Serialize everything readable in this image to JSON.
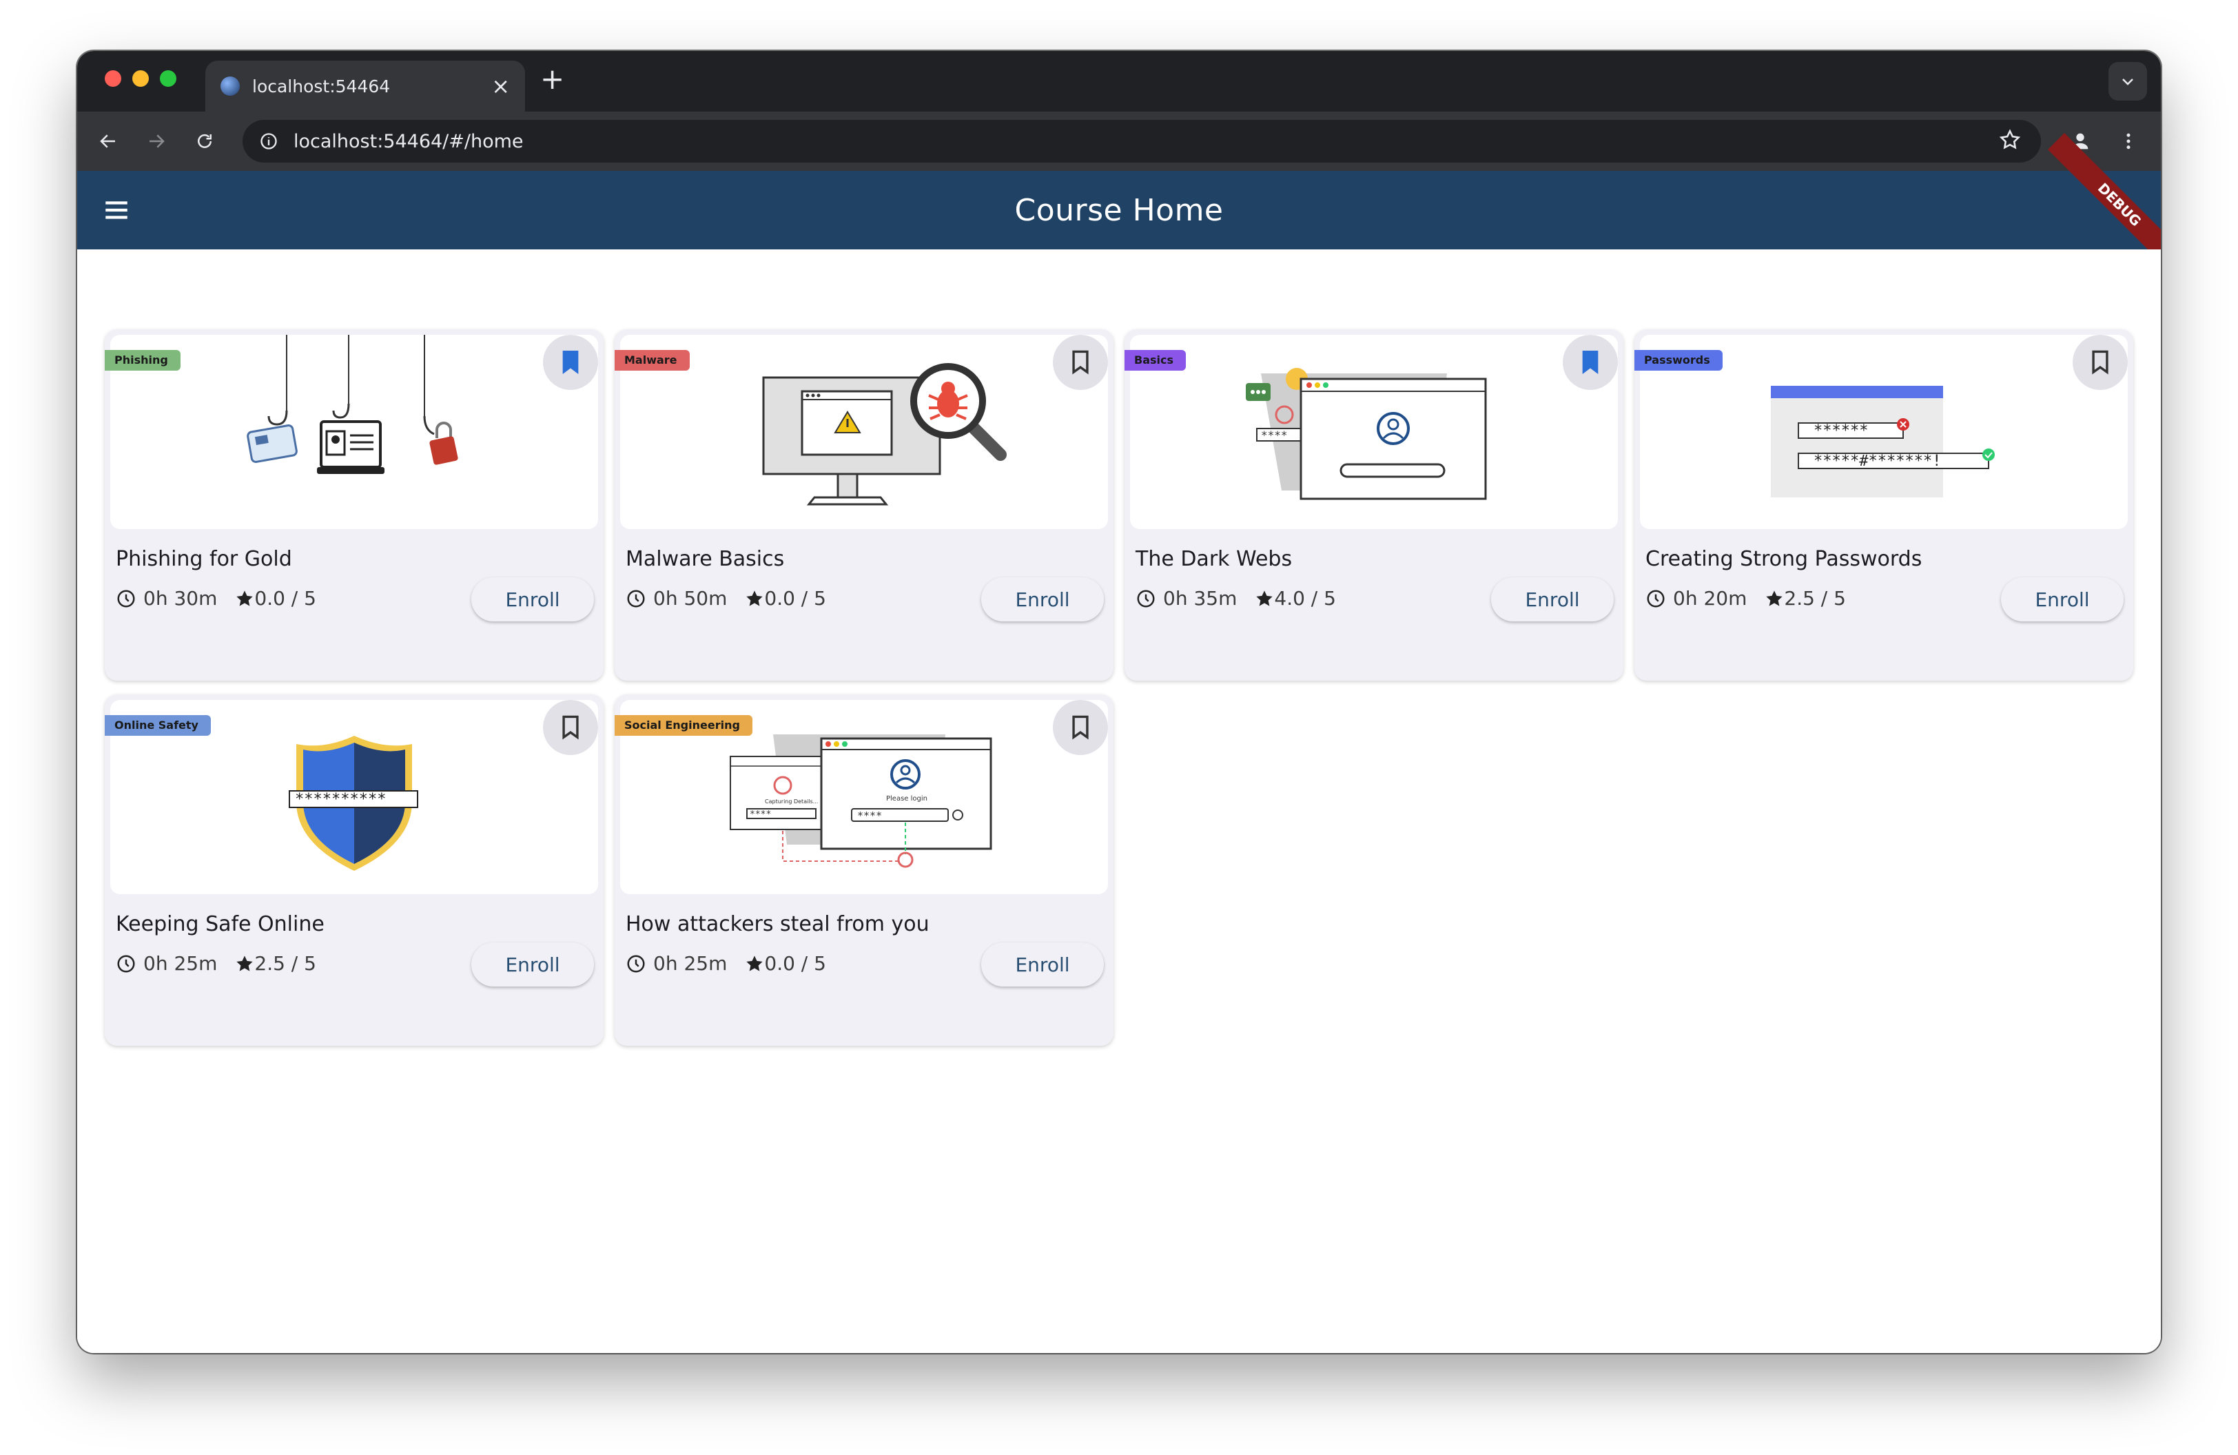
{
  "browser": {
    "tab_title": "localhost:54464",
    "url": "localhost:54464/#/home"
  },
  "appbar": {
    "title": "Course Home",
    "debug_label": "DEBUG"
  },
  "colors": {
    "appbar": "#1f4265",
    "accent_text": "#284e72",
    "bookmark_active": "#2a6fd6"
  },
  "courses": [
    {
      "tag": "Phishing",
      "tag_color": "#7fba7c",
      "title": "Phishing for Gold",
      "duration": "0h 30m",
      "rating": "0.0 / 5",
      "enroll": "Enroll",
      "bookmarked": true,
      "icon": "phishing-illustration"
    },
    {
      "tag": "Malware",
      "tag_color": "#e06363",
      "title": "Malware Basics",
      "duration": "0h 50m",
      "rating": "0.0 / 5",
      "enroll": "Enroll",
      "bookmarked": false,
      "icon": "malware-illustration"
    },
    {
      "tag": "Basics",
      "tag_color": "#8a55e8",
      "title": "The Dark Webs",
      "duration": "0h 35m",
      "rating": "4.0 / 5",
      "enroll": "Enroll",
      "bookmarked": true,
      "icon": "darkweb-illustration"
    },
    {
      "tag": "Passwords",
      "tag_color": "#5a73e8",
      "title": "Creating Strong Passwords",
      "duration": "0h 20m",
      "rating": "2.5 / 5",
      "enroll": "Enroll",
      "bookmarked": false,
      "icon": "passwords-illustration"
    },
    {
      "tag": "Online Safety",
      "tag_color": "#6f95d8",
      "title": "Keeping Safe Online",
      "duration": "0h 25m",
      "rating": "2.5 / 5",
      "enroll": "Enroll",
      "bookmarked": false,
      "icon": "shield-illustration"
    },
    {
      "tag": "Social Engineering",
      "tag_color": "#e8a94a",
      "title": "How attackers steal from you",
      "duration": "0h 25m",
      "rating": "0.0 / 5",
      "enroll": "Enroll",
      "bookmarked": false,
      "icon": "social-engineering-illustration"
    }
  ],
  "illustration_text": {
    "masked_short": "******",
    "masked_long": "*****#*******!",
    "shield_mask": "**********",
    "four_stars": "****",
    "please_login": "Please login",
    "capturing_details": "Capturing Details..."
  }
}
